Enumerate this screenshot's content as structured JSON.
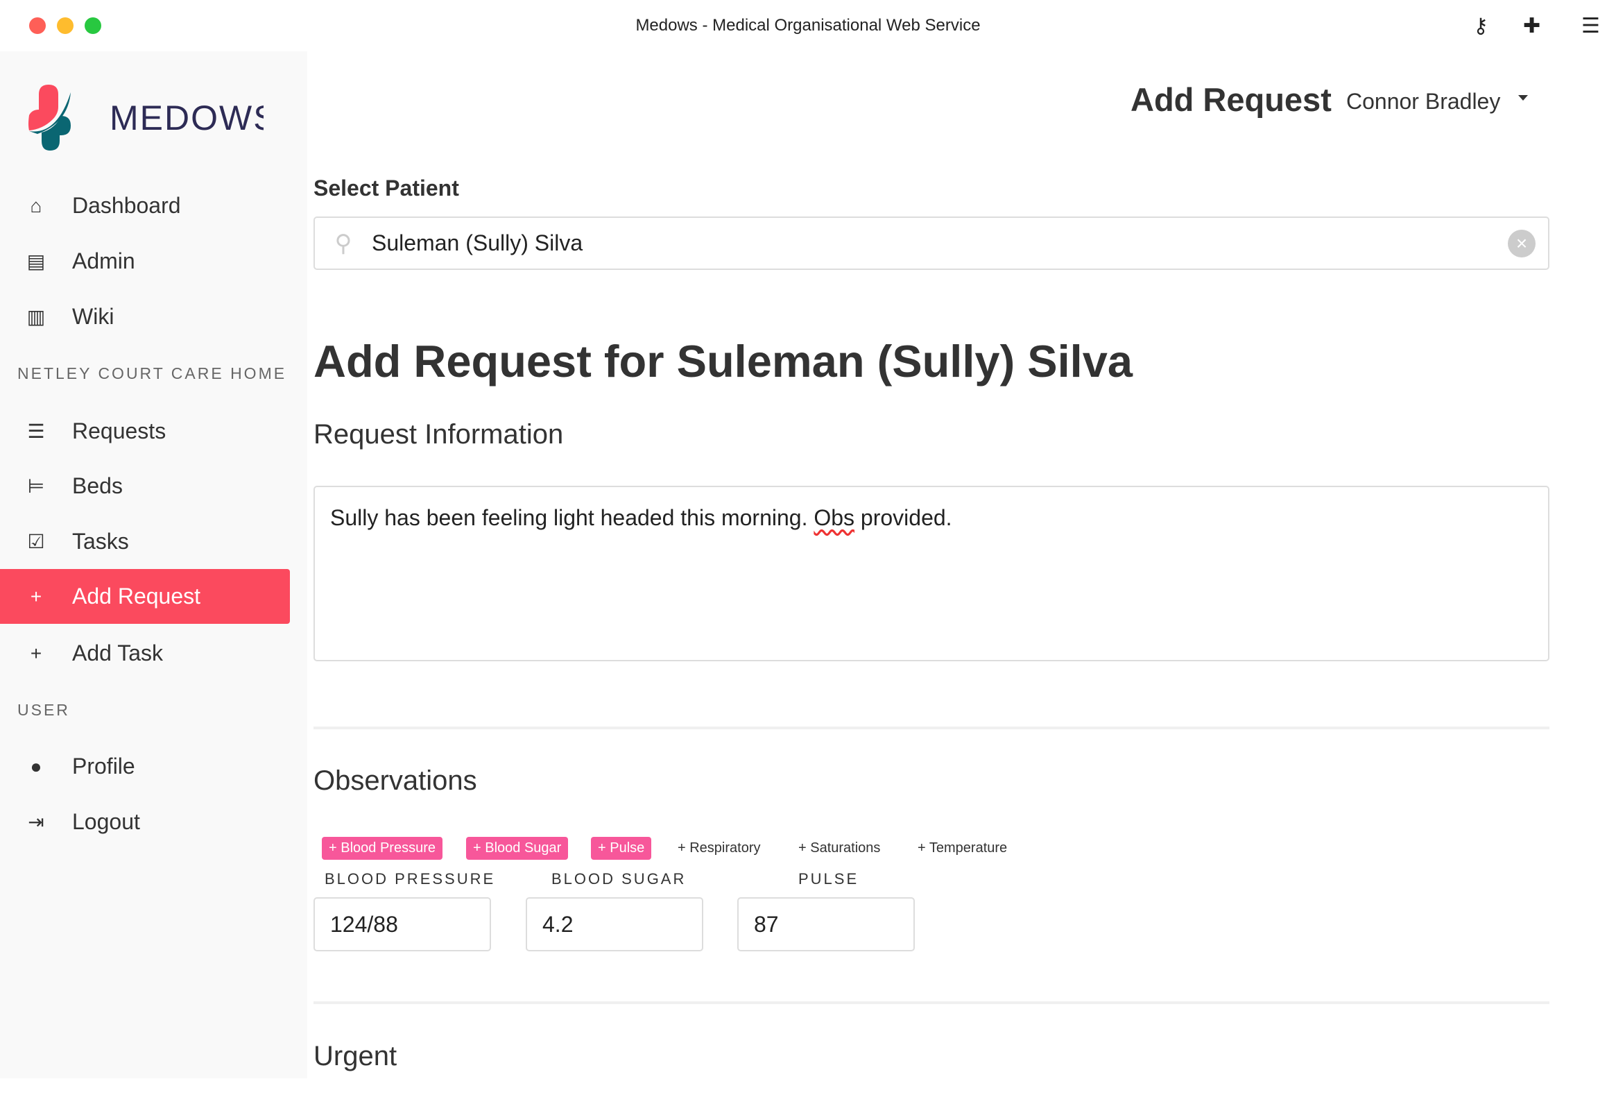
{
  "window": {
    "title": "Medows - Medical Organisational Web Service"
  },
  "logo": {
    "text": "MEDOWS",
    "colors": {
      "red": "#fb4a5e",
      "teal": "#0a6672",
      "navy": "#2d2b55"
    }
  },
  "sidebar": {
    "items": [
      {
        "label": "Dashboard",
        "icon": "houses-icon"
      },
      {
        "label": "Admin",
        "icon": "id-card-icon"
      },
      {
        "label": "Wiki",
        "icon": "books-icon"
      }
    ],
    "section_home": "NETLEY COURT CARE HOME",
    "home_items": [
      {
        "label": "Requests",
        "icon": "list-icon"
      },
      {
        "label": "Beds",
        "icon": "bed-icon"
      },
      {
        "label": "Tasks",
        "icon": "clipboard-check-icon"
      },
      {
        "label": "Add Request",
        "icon": "plus-icon",
        "active": true
      },
      {
        "label": "Add Task",
        "icon": "plus-icon"
      }
    ],
    "section_user": "USER",
    "user_items": [
      {
        "label": "Profile",
        "icon": "user-icon"
      },
      {
        "label": "Logout",
        "icon": "logout-icon"
      }
    ]
  },
  "header": {
    "title": "Add Request",
    "user": "Connor Bradley"
  },
  "form": {
    "select_label": "Select Patient",
    "patient_value": "Suleman (Sully) Silva",
    "heading": "Add Request for Suleman (Sully) Silva",
    "request_info_label": "Request Information",
    "request_text_before": "Sully has been feeling light headed this morning. ",
    "request_text_misspelled": "Obs",
    "request_text_after": " provided.",
    "observations_label": "Observations",
    "chips": [
      {
        "label": "+ Blood Pressure",
        "active": true
      },
      {
        "label": "+ Blood Sugar",
        "active": true
      },
      {
        "label": "+ Pulse",
        "active": true
      },
      {
        "label": "+ Respiratory",
        "active": false
      },
      {
        "label": "+ Saturations",
        "active": false
      },
      {
        "label": "+ Temperature",
        "active": false
      }
    ],
    "obs": [
      {
        "label": "BLOOD PRESSURE",
        "value": "124/88"
      },
      {
        "label": "BLOOD SUGAR",
        "value": "4.2"
      },
      {
        "label": "PULSE",
        "value": "87"
      }
    ],
    "urgent_label": "Urgent"
  },
  "accent": "#fb4a5e",
  "chip_color": "#f7579a"
}
